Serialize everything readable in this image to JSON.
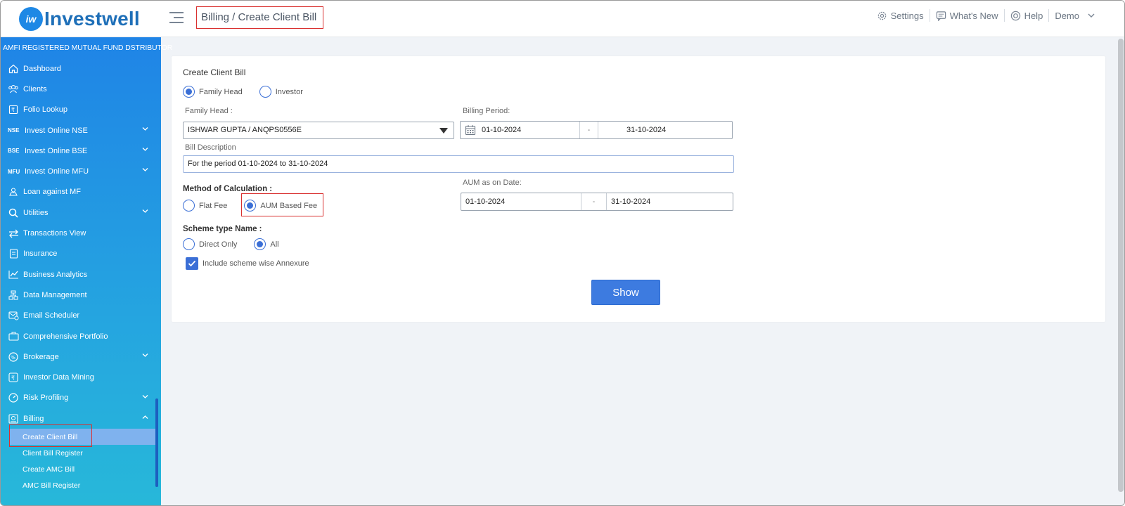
{
  "app": {
    "logo_mark": "iw",
    "logo_text": "Investwell"
  },
  "header": {
    "breadcrumb": "Billing / Create Client Bill",
    "settings": "Settings",
    "whats_new": "What's New",
    "help": "Help",
    "user": "Demo"
  },
  "sidebar": {
    "title": "AMFI REGISTERED MUTUAL FUND DSTRIBUTOR",
    "items": [
      {
        "label": "Dashboard",
        "icon": "home-icon"
      },
      {
        "label": "Clients",
        "icon": "clients-icon"
      },
      {
        "label": "Folio Lookup",
        "icon": "folio-icon"
      },
      {
        "label": "Invest Online NSE",
        "icon_text": "NSE",
        "expandable": true
      },
      {
        "label": "Invest Online BSE",
        "icon_text": "BSE",
        "expandable": true
      },
      {
        "label": "Invest Online MFU",
        "icon_text": "MFU",
        "expandable": true
      },
      {
        "label": "Loan against MF",
        "icon": "loan-icon"
      },
      {
        "label": "Utilities",
        "icon": "utilities-icon",
        "expandable": true
      },
      {
        "label": "Transactions View",
        "icon": "transactions-icon"
      },
      {
        "label": "Insurance",
        "icon": "insurance-icon"
      },
      {
        "label": "Business Analytics",
        "icon": "analytics-icon"
      },
      {
        "label": "Data Management",
        "icon": "data-icon"
      },
      {
        "label": "Email Scheduler",
        "icon": "email-icon"
      },
      {
        "label": "Comprehensive Portfolio",
        "icon": "portfolio-icon"
      },
      {
        "label": "Brokerage",
        "icon": "brokerage-icon",
        "expandable": true
      },
      {
        "label": "Investor Data Mining",
        "icon": "rupee-icon"
      },
      {
        "label": "Risk Profiling",
        "icon": "risk-icon",
        "expandable": true
      },
      {
        "label": "Billing",
        "icon": "billing-icon",
        "expanded": true
      }
    ],
    "billing_sub": [
      {
        "label": "Create Client Bill",
        "active": true
      },
      {
        "label": "Client Bill Register"
      },
      {
        "label": "Create AMC Bill"
      },
      {
        "label": "AMC Bill Register"
      }
    ]
  },
  "form": {
    "title": "Create Client Bill",
    "bill_for": {
      "options": [
        "Family Head",
        "Investor"
      ],
      "selected": "Family Head"
    },
    "family_head_label": "Family Head :",
    "family_head_value": "ISHWAR GUPTA / ANQPS0556E",
    "billing_period_label": "Billing Period:",
    "billing_from": "01-10-2024",
    "billing_to": "31-10-2024",
    "separator": "-",
    "bill_description_label": "Bill Description",
    "bill_description_value": "For the period 01-10-2024 to 31-10-2024",
    "method_label": "Method of Calculation :",
    "method": {
      "options": [
        "Flat Fee",
        "AUM Based Fee"
      ],
      "selected": "AUM Based Fee"
    },
    "aum_label": "AUM as on Date:",
    "aum_from": "01-10-2024",
    "aum_to": "31-10-2024",
    "scheme_type_label": "Scheme type Name :",
    "scheme_type": {
      "options": [
        "Direct Only",
        "All"
      ],
      "selected": "All"
    },
    "annexure_label": "Include scheme wise Annexure",
    "annexure_checked": true,
    "show_button": "Show"
  },
  "colors": {
    "accent": "#3b6fd6",
    "highlight": "#d9302f",
    "sidebar_top": "#1f84e6",
    "sidebar_bottom": "#27b8d9"
  }
}
